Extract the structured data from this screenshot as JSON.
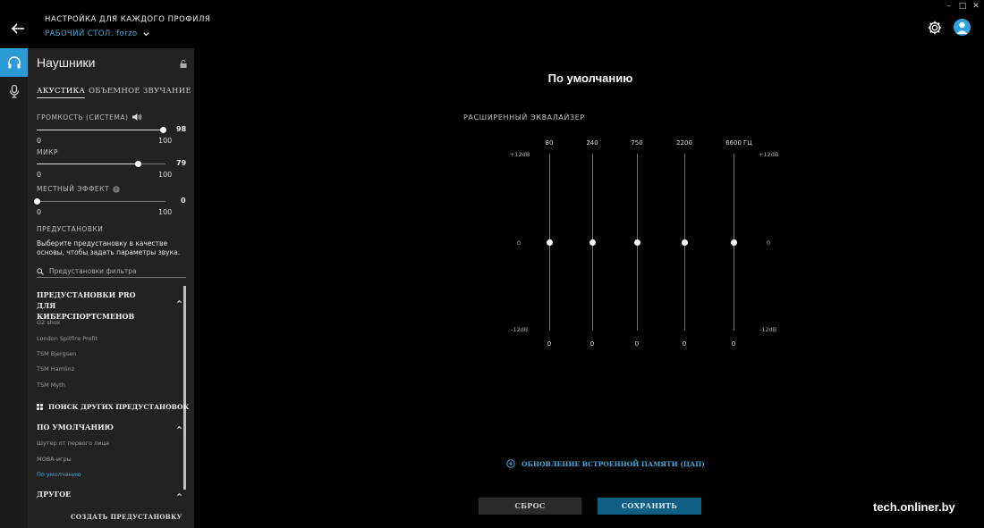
{
  "header": {
    "title": "НАСТРОЙКА ДЛЯ КАЖДОГО ПРОФИЛЯ",
    "profile": "РАБОЧИЙ СТОЛ: forzo"
  },
  "window_controls": {
    "minimize": "–",
    "maximize": "□",
    "close": "✕"
  },
  "panel": {
    "title": "Наушники",
    "tabs": [
      "АКУСТИКА",
      "ОБЪЕМНОЕ ЗВУЧАНИЕ"
    ],
    "volume": {
      "label": "ГРОМКОСТЬ (СИСТЕМА)",
      "value": "98",
      "min": "0",
      "max": "100",
      "fraction": 0.98
    },
    "mic": {
      "label": "МИКР",
      "value": "79",
      "min": "0",
      "max": "100",
      "fraction": 0.79
    },
    "sidetone": {
      "label": "МЕСТНЫЙ ЭФФЕКТ",
      "value": "0",
      "min": "0",
      "max": "100",
      "fraction": 0.0
    },
    "presets_label": "ПРЕДУСТАНОВКИ",
    "presets_desc": "Выберите предустановку в качестве основы, чтобы задать параметры звука.",
    "filter_placeholder": "Предустановки фильтра",
    "pro_section": "ПРЕДУСТАНОВКИ PRO ДЛЯ КИБЕРСПОРТСМЕНОВ",
    "pro_items": [
      "G2 shox",
      "London Spitfire Profit",
      "TSM Bjergsen",
      "TSM Hamlinz",
      "TSM Myth"
    ],
    "find_more": "ПОИСК ДРУГИХ ПРЕДУСТАНОВОК",
    "default_section": "ПО УМОЛЧАНИЮ",
    "default_items": [
      "Шутер от первого лица",
      "MOBA-игры",
      "По умолчанию"
    ],
    "other_section": "ДРУГОЕ",
    "create": "СОЗДАТЬ ПРЕДУСТАНОВКУ"
  },
  "main": {
    "title": "По умолчанию",
    "eq_label": "РАСШИРЕННЫЙ ЭКВАЛАЙЗЕР",
    "hz_unit": "ГЦ",
    "db_top": "+12dB",
    "db_mid": "0",
    "db_bottom": "-12dB",
    "bands": [
      {
        "freq": "80",
        "gain": "0"
      },
      {
        "freq": "240",
        "gain": "0"
      },
      {
        "freq": "750",
        "gain": "0"
      },
      {
        "freq": "2200",
        "gain": "0"
      },
      {
        "freq": "6600",
        "gain": "0"
      }
    ],
    "firmware": "ОБНОВЛЕНИЕ ВСТРОЕННОЙ ПАМЯТИ (ЦАП)",
    "reset": "СБРОС",
    "save": "СОХРАНИТЬ"
  },
  "watermark": "tech.onliner.by",
  "colors": {
    "accent": "#2b9bd6",
    "panel": "#222222",
    "save": "#0f5f85"
  }
}
